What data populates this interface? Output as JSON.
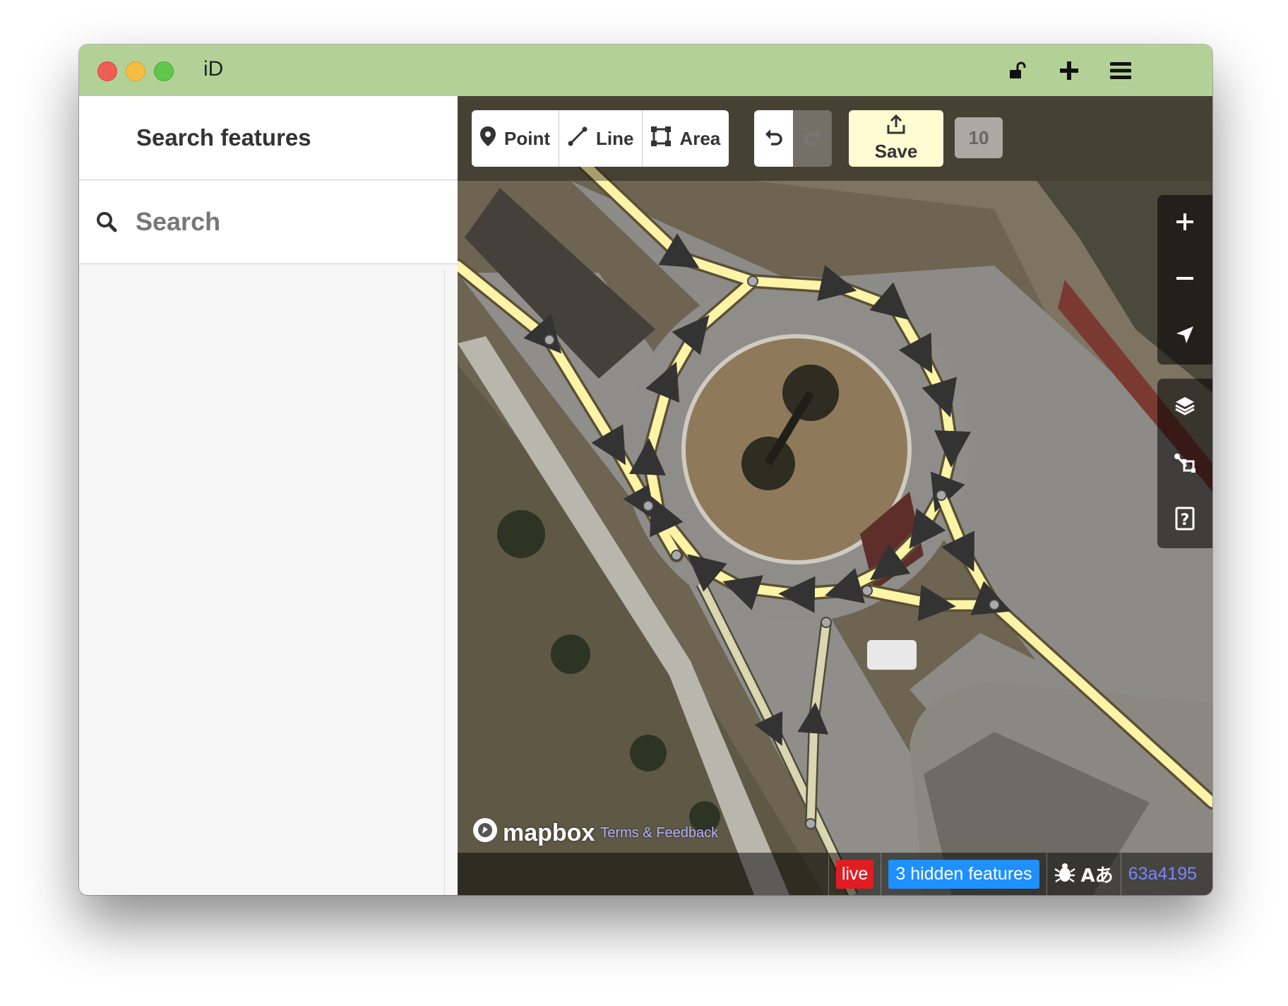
{
  "window": {
    "title": "iD"
  },
  "titlebar_icons": [
    "unlock-icon",
    "plus-icon",
    "hamburger-menu-icon"
  ],
  "sidebar": {
    "header_title": "Search features",
    "search_placeholder": "Search"
  },
  "toolbar": {
    "modes": [
      {
        "label": "Point",
        "icon": "point-marker-icon"
      },
      {
        "label": "Line",
        "icon": "line-icon"
      },
      {
        "label": "Area",
        "icon": "area-icon"
      }
    ],
    "undo_icon": "undo-icon",
    "redo_icon": "redo-icon",
    "save_label": "Save",
    "save_icon": "upload-icon",
    "edit_count": "10"
  },
  "map_controls": {
    "zoom_in_icon": "zoom-in-plus-icon",
    "zoom_out_icon": "zoom-out-minus-icon",
    "geolocate_icon": "geolocate-arrow-icon",
    "background_icon": "layers-icon",
    "map_data_icon": "map-data-icon",
    "help_icon": "help-question-icon"
  },
  "attribution": {
    "logo_text": "mapbox",
    "terms_link": "Terms & Feedback"
  },
  "footer": {
    "live_label": "live",
    "hidden_features": "3 hidden features",
    "issues_icon": "bug-icon",
    "language_text": "Aあ",
    "version": "63a4195"
  },
  "colors": {
    "titlebar": "#b3d197",
    "road": "#fff5a8",
    "path": "#d9d6b0",
    "live": "#e01d22",
    "hidden_features": "#1e90ff",
    "version_link": "#7a85ff"
  }
}
